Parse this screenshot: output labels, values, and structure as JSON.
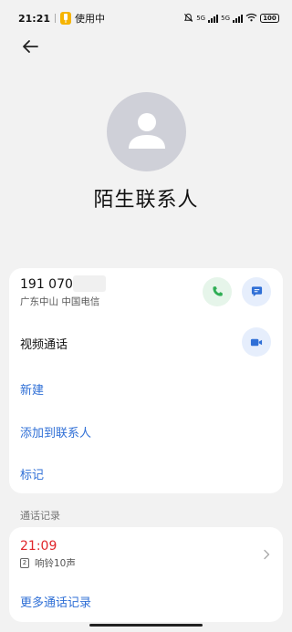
{
  "status_bar": {
    "time": "21:21",
    "in_use_label": "使用中",
    "network_1": "5G",
    "network_2": "5G",
    "battery": "100"
  },
  "contact": {
    "name": "陌生联系人",
    "phone_number": "191 070",
    "location": "广东中山  中国电信"
  },
  "actions": {
    "video_call_label": "视频通话",
    "new_label": "新建",
    "add_to_contacts_label": "添加到联系人",
    "mark_label": "标记"
  },
  "call_log": {
    "section_title": "通话记录",
    "entries": [
      {
        "time": "21:09",
        "sim": "2",
        "detail": "响铃10声"
      }
    ],
    "more_label": "更多通话记录"
  },
  "colors": {
    "link_blue": "#2f6fd6",
    "missed_red": "#e0262b",
    "call_green": "#2fae55"
  },
  "icons": {
    "back": "arrow-left-icon",
    "avatar": "person-icon",
    "call": "phone-icon",
    "message": "message-icon",
    "video": "video-camera-icon",
    "log_chevron": "chevron-right-icon"
  }
}
